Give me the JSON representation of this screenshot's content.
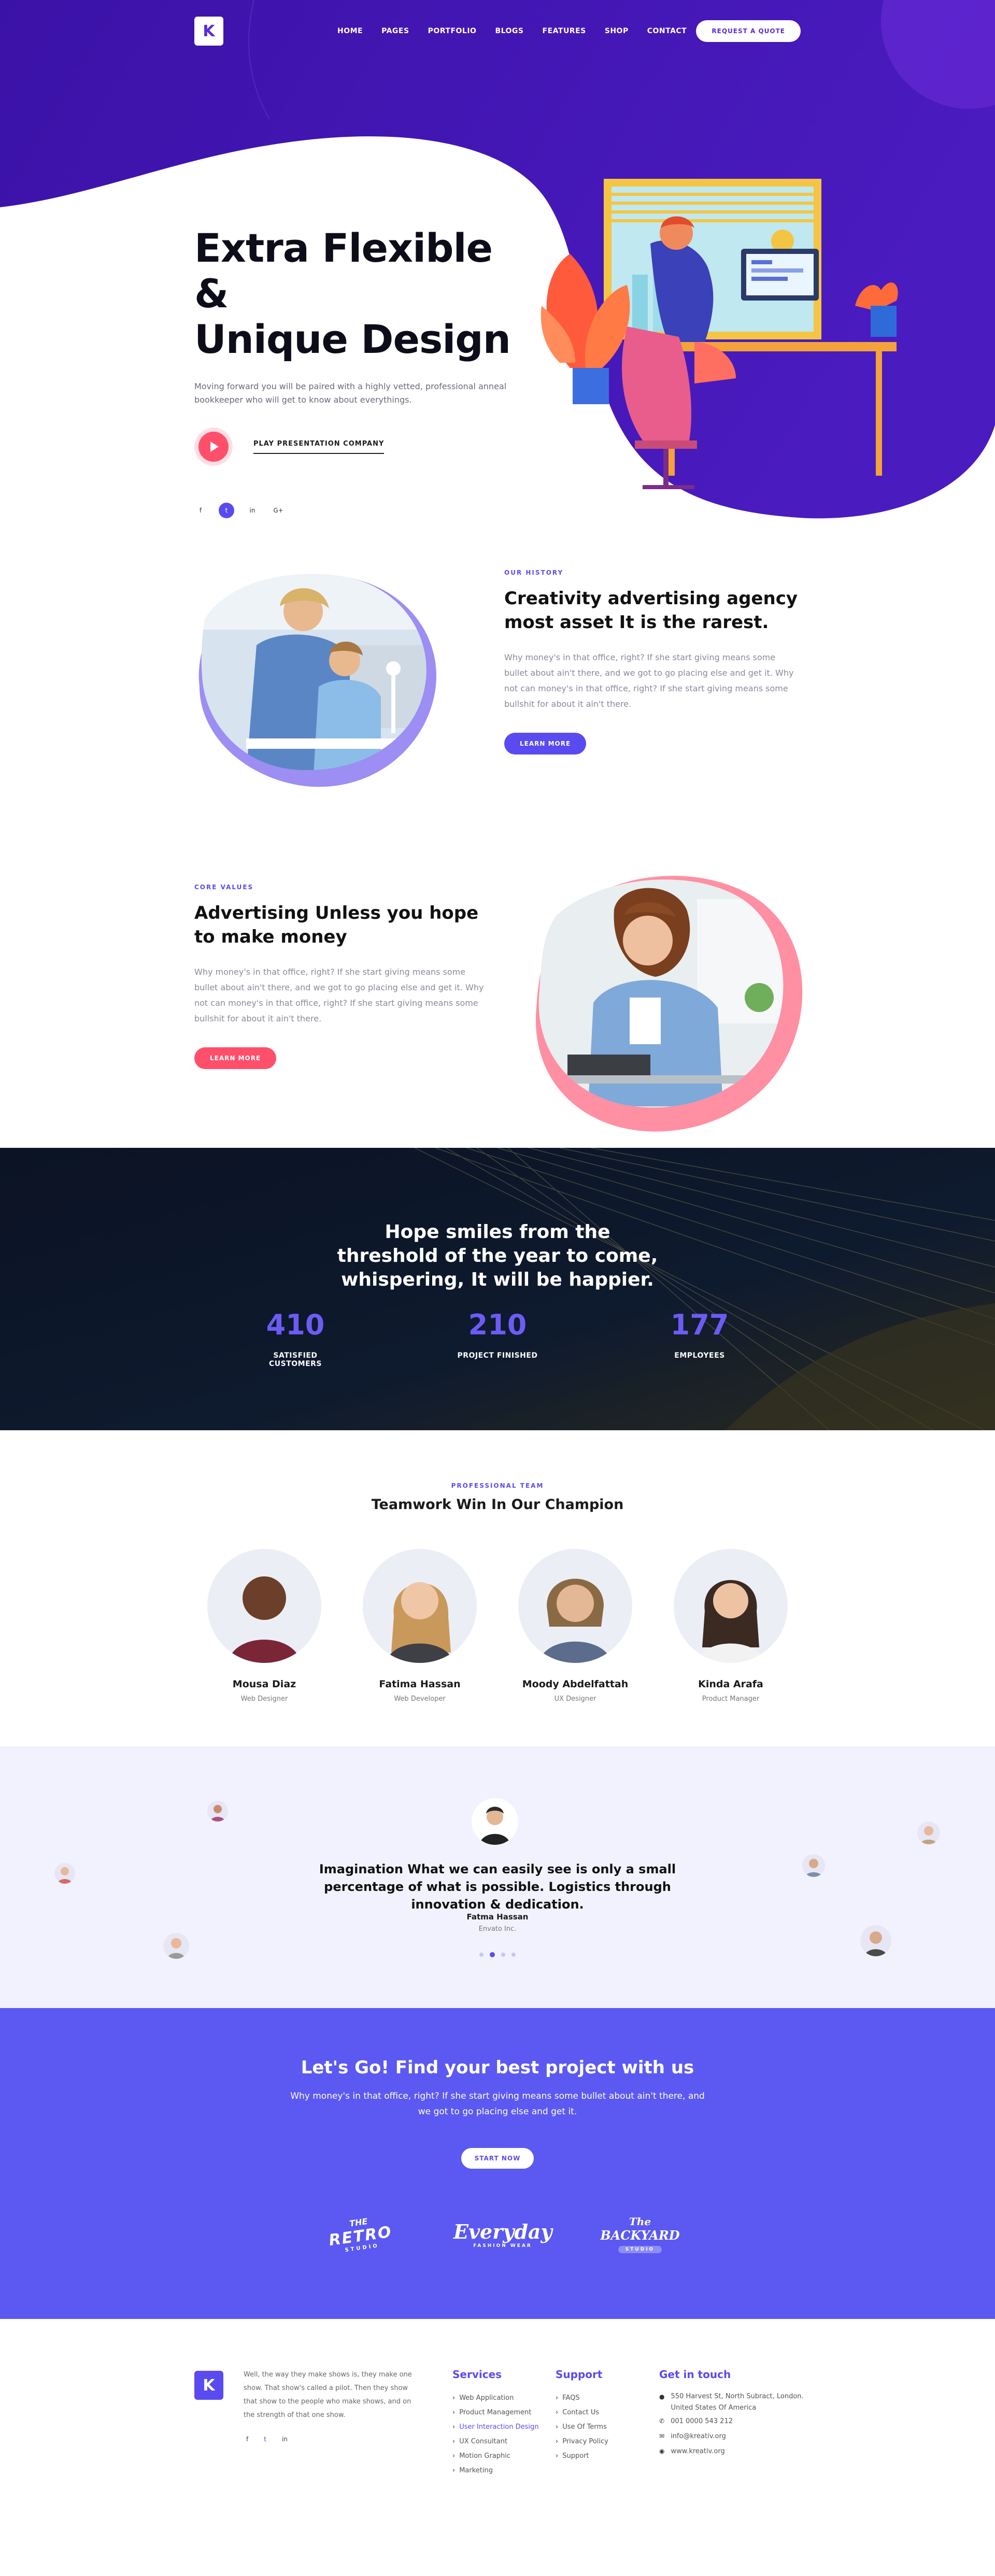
{
  "nav": {
    "logo": "K",
    "menu": [
      "HOME",
      "PAGES",
      "PORTFOLIO",
      "BLOGS",
      "FEATURES",
      "SHOP",
      "CONTACT"
    ],
    "quote_button": "REQUEST A QUOTE"
  },
  "hero": {
    "title_line1": "Extra Flexible &",
    "title_line2": "Unique Design",
    "description": "Moving forward you will be paired with a highly vetted, professional anneal bookkeeper who will get to know about everythings.",
    "play_label": "PLAY PRESENTATION COMPANY",
    "social": [
      "f",
      "t",
      "in",
      "G+"
    ]
  },
  "history": {
    "kicker": "OUR HISTORY",
    "title": "Creativity advertising agency most asset It is the rarest.",
    "body": "Why money's in that office, right? If she start giving means some bullet about ain't there, and we got to go placing else and get it. Why not can money's in that office, right? If she start giving means some bullshit for about it ain't there.",
    "button": "LEARN MORE"
  },
  "values": {
    "kicker": "CORE VALUES",
    "title": "Advertising Unless you hope to make money",
    "body": "Why money's in that office, right? If she start giving means some bullet about ain't there, and we got to go placing else and get it. Why not can money's in that office, right? If she start giving means some bullshit for about it ain't there.",
    "button": "LEARN MORE"
  },
  "stats": {
    "title": "Hope smiles from the threshold of the year to come, whispering, It will be happier.",
    "items": [
      {
        "value": "410",
        "label": "SATISFIED CUSTOMERS"
      },
      {
        "value": "210",
        "label": "PROJECT FINISHED"
      },
      {
        "value": "177",
        "label": "EMPLOYEES"
      }
    ]
  },
  "team": {
    "kicker": "PROFESSIONAL TEAM",
    "title": "Teamwork Win In Our Champion",
    "members": [
      {
        "name": "Mousa Diaz",
        "role": "Web Designer"
      },
      {
        "name": "Fatima Hassan",
        "role": "Web Developer"
      },
      {
        "name": "Moody Abdelfattah",
        "role": "UX Designer"
      },
      {
        "name": "Kinda Arafa",
        "role": "Product Manager"
      }
    ]
  },
  "testimonial": {
    "quote": "Imagination What we can easily see is only a small percentage of what is possible. Logistics through innovation & dedication.",
    "name": "Fatma Hassan",
    "company": "Envato Inc."
  },
  "cta": {
    "title": "Let's Go! Find your best project with us",
    "body": "Why money's in that office, right? If she start giving means some bullet about ain't there, and we got to go placing else and get it.",
    "button": "START NOW",
    "brands": [
      {
        "top": "THE",
        "main": "RETRO",
        "sub": "STUDIO"
      },
      {
        "top": "",
        "main": "Everyday",
        "sub": "FASHION WEAR"
      },
      {
        "top": "The",
        "main": "BACKYARD",
        "sub": "STUDIO"
      }
    ]
  },
  "footer": {
    "logo": "K",
    "about": "Well, the way they make shows is, they make one show. That show's called a pilot. Then they show that show to the people who make shows, and on the strength of that one show.",
    "social": [
      "f",
      "t",
      "in"
    ],
    "services_title": "Services",
    "services": [
      "Web Application",
      "Product Management",
      "User Interaction Design",
      "UX Consultant",
      "Motion Graphic",
      "Marketing"
    ],
    "support_title": "Support",
    "support": [
      "FAQS",
      "Contact Us",
      "Use Of Terms",
      "Privacy Policy",
      "Support"
    ],
    "contact_title": "Get in touch",
    "contact": [
      "550 Harvest St, North Subract, London. United States Of America",
      "001 0000 543 212",
      "info@kreativ.org",
      "www.kreativ.org"
    ]
  },
  "colors": {
    "primary": "#5a4bf0",
    "hero_purple": "#3d15b0",
    "accent_pink": "#ff4f6a"
  }
}
